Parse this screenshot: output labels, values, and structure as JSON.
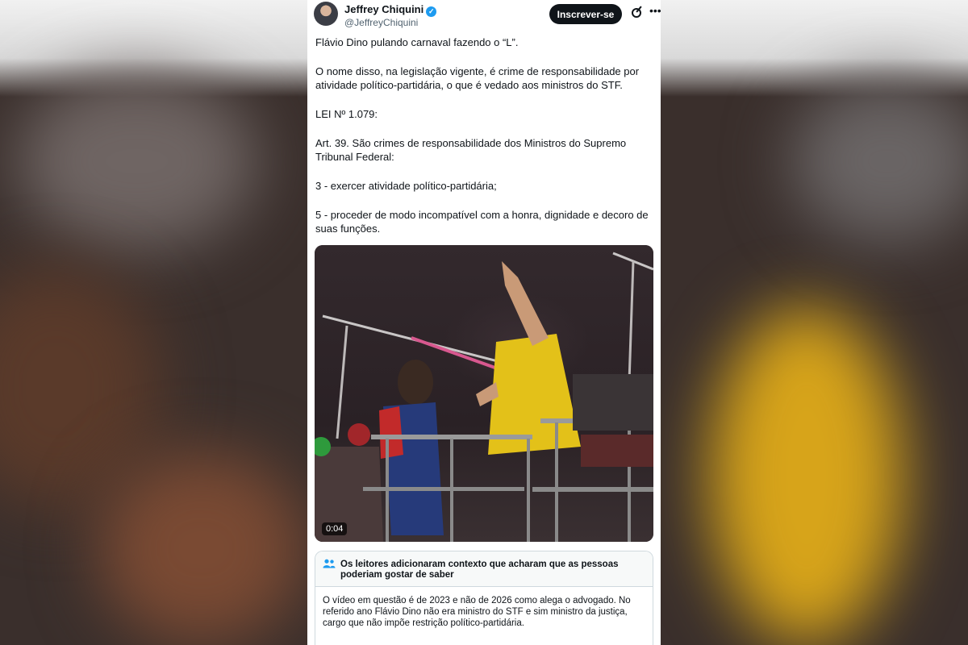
{
  "tweet": {
    "author_name": "Jeffrey Chiquini",
    "author_handle": "@JeffreyChiquini",
    "subscribe_label": "Inscrever-se",
    "icons": [
      "verified-badge-icon",
      "grok-icon",
      "more-icon"
    ],
    "paragraphs": [
      "Flávio Dino pulando carnaval fazendo o “L”.",
      "O nome disso, na legislação vigente, é crime de responsabilidade por atividade político-partidária, o que é vedado aos ministros do STF.",
      "LEI Nº 1.079:",
      "Art. 39. São crimes de responsabilidade dos Ministros do Supremo Tribunal Federal:",
      "3 - exercer atividade político-partidária;",
      "5 - proceder de modo incompatível com a honra, dignidade e decoro de suas funções."
    ],
    "video_time": "0:04"
  },
  "community_note": {
    "title": "Os leitores adicionaram contexto que acharam que as pessoas poderiam gostar de saber",
    "body": "O vídeo em questão é de 2023 e não de 2026 como alega o advogado. No referido ano Flávio Dino não era ministro do STF e sim ministro da justiça, cargo que não impõe restrição político-partidária."
  },
  "colors": {
    "accent": "#1d9bf0",
    "button_bg": "#0f1419",
    "secondary_text": "#536471",
    "border": "#cfd9de"
  }
}
